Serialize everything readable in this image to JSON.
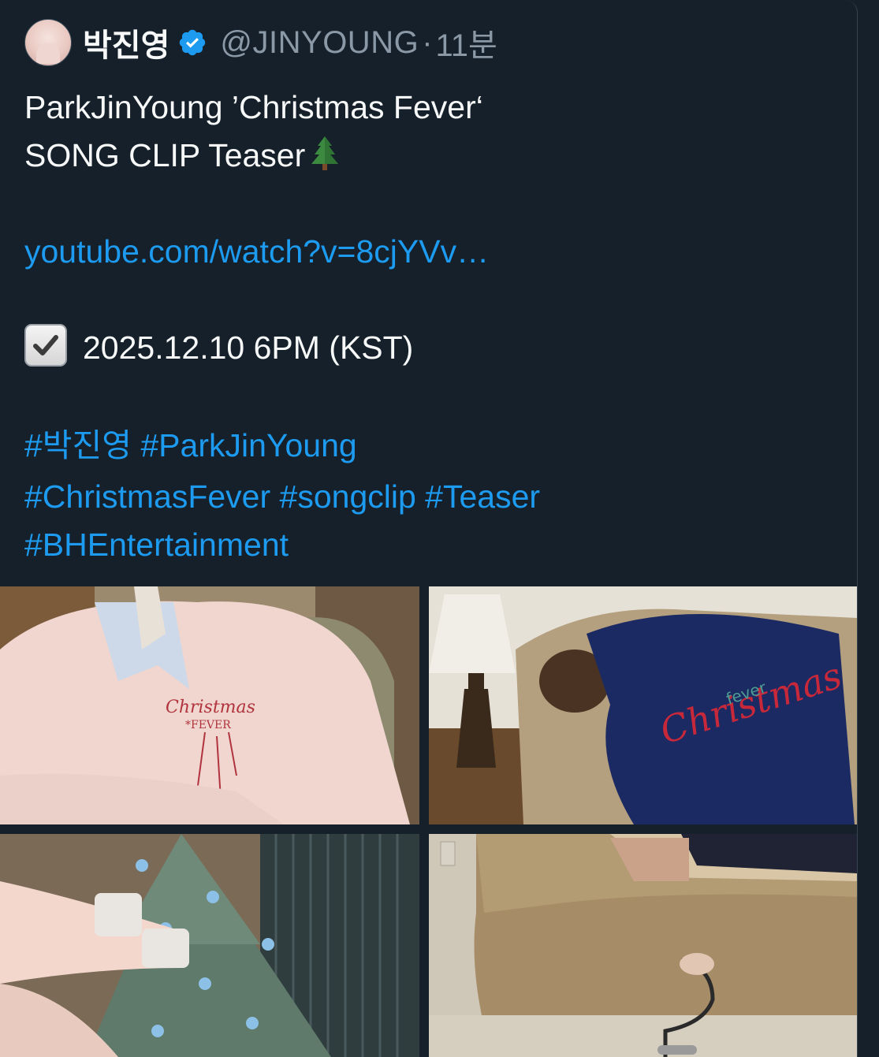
{
  "tweet": {
    "author_name": "박진영",
    "handle": "@JINYOUNG",
    "separator": "·",
    "time": "11분",
    "text_line1": "ParkJinYoung ’Christmas Fever‘",
    "text_line2": "SONG CLIP Teaser",
    "link": "youtube.com/watch?v=8cjYVv…",
    "date_line": "2025.12.10 6PM (KST)",
    "hashtags_line1": [
      "#박진영",
      "#ParkJinYoung"
    ],
    "hashtags_line2": [
      "#ChristmasFever",
      "#songclip",
      "#Teaser"
    ],
    "hashtags_line3": [
      "#BHEntertainment"
    ]
  },
  "colors": {
    "background": "#15202b",
    "text": "#f7f9f9",
    "secondary": "#8b98a5",
    "link": "#1d9bf0",
    "verified": "#1d9bf0"
  },
  "icons": {
    "verified": "verified-badge-icon",
    "tree": "christmas-tree-emoji",
    "check": "check-box-emoji"
  }
}
